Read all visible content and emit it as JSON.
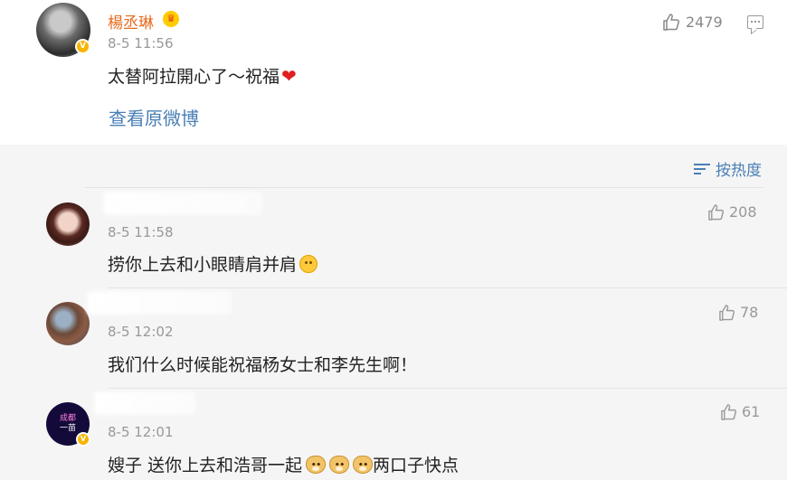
{
  "post": {
    "author": "楊丞琳",
    "time": "8-5 11:56",
    "text": "太替阿拉開心了～祝福",
    "emoji": "❤",
    "view_original": "查看原微博",
    "likes": "2479",
    "avatar_badge": "V"
  },
  "comments_header": {
    "sort_label": "按热度"
  },
  "comments": [
    {
      "time": "8-5 11:58",
      "text": "捞你上去和小眼睛肩并肩",
      "likes": "208",
      "emoji": "drooling-face"
    },
    {
      "time": "8-5 12:02",
      "text": "我们什么时候能祝福杨女士和李先生啊！",
      "likes": "78"
    },
    {
      "time": "8-5 12:01",
      "text": "嫂子 送你上去和浩哥一起",
      "text_after": "两口子快点",
      "likes": "61",
      "avatar_badge": "V",
      "avatar_text_1": "成都",
      "avatar_text_2": "一苗"
    }
  ],
  "colors": {
    "author_name": "#e86a1e",
    "link": "#4a7fb5",
    "secondary_text": "#999999",
    "panel_bg": "#f5f5f5"
  }
}
